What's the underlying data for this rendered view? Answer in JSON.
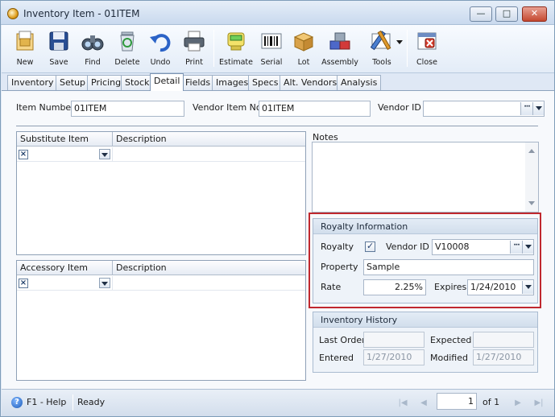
{
  "window": {
    "title": "Inventory Item - 01ITEM",
    "minimize_glyph": "—",
    "maximize_glyph": "□",
    "close_glyph": "✕"
  },
  "toolbar": {
    "items": [
      {
        "id": "new",
        "label": "New",
        "icon": "new-document-icon"
      },
      {
        "id": "save",
        "label": "Save",
        "icon": "floppy-disk-icon"
      },
      {
        "id": "find",
        "label": "Find",
        "icon": "binoculars-icon"
      },
      {
        "id": "delete",
        "label": "Delete",
        "icon": "recycle-bin-icon"
      },
      {
        "id": "undo",
        "label": "Undo",
        "icon": "undo-arrow-icon"
      },
      {
        "id": "print",
        "label": "Print",
        "icon": "printer-icon"
      },
      {
        "id": "estimate",
        "label": "Estimate",
        "icon": "calculator-icon"
      },
      {
        "id": "serial",
        "label": "Serial",
        "icon": "barcode-icon"
      },
      {
        "id": "lot",
        "label": "Lot",
        "icon": "lot-boxes-icon"
      },
      {
        "id": "assembly",
        "label": "Assembly",
        "icon": "assembly-blocks-icon"
      },
      {
        "id": "tools",
        "label": "Tools",
        "icon": "tools-icon"
      },
      {
        "id": "close",
        "label": "Close",
        "icon": "close-window-icon"
      }
    ]
  },
  "tabs": [
    {
      "label": "Inventory"
    },
    {
      "label": "Setup"
    },
    {
      "label": "Pricing"
    },
    {
      "label": "Stock"
    },
    {
      "label": "Detail",
      "active": true
    },
    {
      "label": "Fields"
    },
    {
      "label": "Images"
    },
    {
      "label": "Specs"
    },
    {
      "label": "Alt. Vendors"
    },
    {
      "label": "Analysis"
    }
  ],
  "header": {
    "item_number_label": "Item Number",
    "item_number": "01ITEM",
    "vendor_item_no_label": "Vendor Item No",
    "vendor_item_no": "01ITEM",
    "vendor_id_label": "Vendor ID",
    "vendor_id": ""
  },
  "substitute_grid": {
    "columns": [
      "Substitute Item",
      "Description"
    ],
    "rows": [
      {
        "item": "",
        "description": ""
      }
    ]
  },
  "accessory_grid": {
    "columns": [
      "Accessory Item",
      "Description"
    ],
    "rows": [
      {
        "item": "",
        "description": ""
      }
    ]
  },
  "notes": {
    "label": "Notes",
    "value": ""
  },
  "royalty": {
    "title": "Royalty Information",
    "royalty_label": "Royalty",
    "royalty_checked": true,
    "check_glyph": "✓",
    "vendor_id_label": "Vendor ID",
    "vendor_id": "V10008",
    "property_label": "Property",
    "property": "Sample",
    "rate_label": "Rate",
    "rate": "2.25%",
    "expires_label": "Expires",
    "expires": "1/24/2010"
  },
  "history": {
    "title": "Inventory History",
    "last_order_label": "Last Order",
    "last_order": "",
    "expected_label": "Expected",
    "expected": "",
    "entered_label": "Entered",
    "entered": "1/27/2010",
    "modified_label": "Modified",
    "modified": "1/27/2010"
  },
  "status": {
    "help": "F1 - Help",
    "state": "Ready",
    "page": "1",
    "of_label": "of 1"
  },
  "colors": {
    "highlight_border": "#c0282e",
    "window_bg": "#dfe8f5"
  }
}
